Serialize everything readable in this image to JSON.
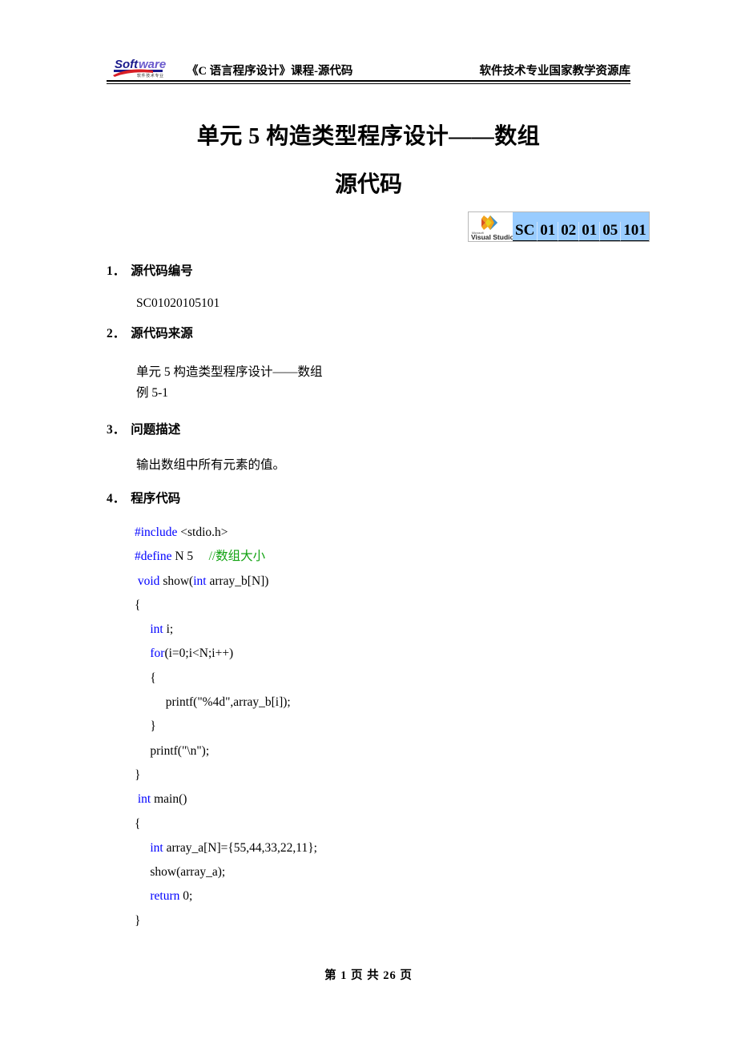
{
  "header": {
    "logo_text": "Software",
    "logo_subtext": "软件技术专业",
    "left_text": "《C 语言程序设计》课程-源代码",
    "right_text": "软件技术专业国家教学资源库"
  },
  "title": {
    "line1": "单元 5  构造类型程序设计——数组",
    "line2": "源代码"
  },
  "badge": {
    "logo_brand": "Microsoft",
    "logo_name": "Visual Studio",
    "cells": [
      "SC",
      "01",
      "02",
      "01",
      "05",
      "101"
    ],
    "background_color": "#99ccff"
  },
  "sections": [
    {
      "number": "1．",
      "heading": "源代码编号",
      "body": [
        "SC01020105101"
      ]
    },
    {
      "number": "2．",
      "heading": "源代码来源",
      "body": [
        "单元 5  构造类型程序设计——数组",
        "例 5-1"
      ]
    },
    {
      "number": "3．",
      "heading": "问题描述",
      "body": [
        "输出数组中所有元素的值。"
      ]
    },
    {
      "number": "4．",
      "heading": "程序代码",
      "body": []
    }
  ],
  "code": {
    "language": "c",
    "keyword_color": "#0000ff",
    "comment_color": "#11a211",
    "lines": [
      [
        {
          "t": "#include",
          "c": "kw"
        },
        {
          "t": " <stdio.h>",
          "c": ""
        }
      ],
      [
        {
          "t": "#define",
          "c": "kw"
        },
        {
          "t": " N 5     ",
          "c": ""
        },
        {
          "t": "//数组大小",
          "c": "cmt"
        }
      ],
      [
        {
          "t": " ",
          "c": ""
        },
        {
          "t": "void",
          "c": "kw"
        },
        {
          "t": " show(",
          "c": ""
        },
        {
          "t": "int",
          "c": "kw"
        },
        {
          "t": " array_b[N])",
          "c": ""
        }
      ],
      [
        {
          "t": "{",
          "c": ""
        }
      ],
      [
        {
          "t": "     ",
          "c": ""
        },
        {
          "t": "int",
          "c": "kw"
        },
        {
          "t": " i;",
          "c": ""
        }
      ],
      [
        {
          "t": "     ",
          "c": ""
        },
        {
          "t": "for",
          "c": "kw"
        },
        {
          "t": "(i=0;i<N;i++)",
          "c": ""
        }
      ],
      [
        {
          "t": "     {",
          "c": ""
        }
      ],
      [
        {
          "t": "          printf(\"%4d\",array_b[i]);",
          "c": ""
        }
      ],
      [
        {
          "t": "     }",
          "c": ""
        }
      ],
      [
        {
          "t": "     printf(\"\\n\");",
          "c": ""
        }
      ],
      [
        {
          "t": "}",
          "c": ""
        }
      ],
      [
        {
          "t": " ",
          "c": ""
        },
        {
          "t": "int",
          "c": "kw"
        },
        {
          "t": " main()",
          "c": ""
        }
      ],
      [
        {
          "t": "{",
          "c": ""
        }
      ],
      [
        {
          "t": "     ",
          "c": ""
        },
        {
          "t": "int",
          "c": "kw"
        },
        {
          "t": " array_a[N]={55,44,33,22,11};",
          "c": ""
        }
      ],
      [
        {
          "t": "     show(array_a);",
          "c": ""
        }
      ],
      [
        {
          "t": "     ",
          "c": ""
        },
        {
          "t": "return",
          "c": "kw"
        },
        {
          "t": " 0;",
          "c": ""
        }
      ],
      [
        {
          "t": "}",
          "c": ""
        }
      ]
    ]
  },
  "footer": {
    "text": "第 1 页 共 26 页"
  }
}
